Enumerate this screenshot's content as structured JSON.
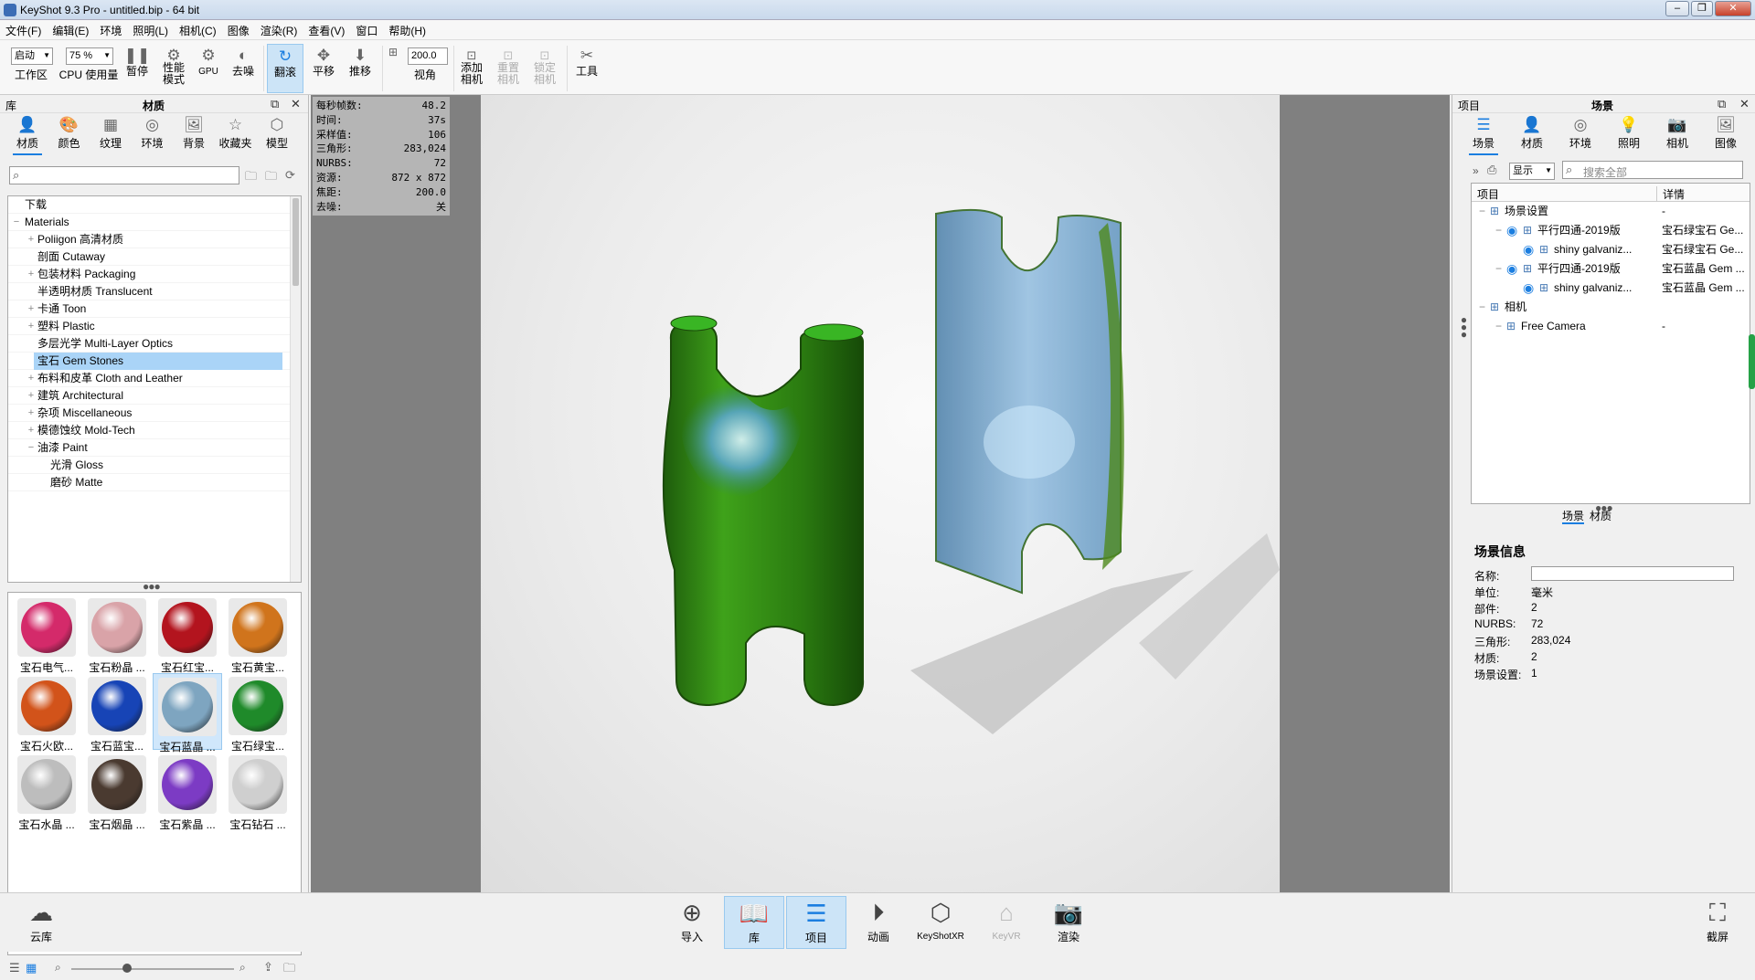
{
  "window": {
    "title": "KeyShot 9.3 Pro  - untitled.bip  - 64 bit"
  },
  "menu": [
    "文件(F)",
    "编辑(E)",
    "环境",
    "照明(L)",
    "相机(C)",
    "图像",
    "渲染(R)",
    "查看(V)",
    "窗口",
    "帮助(H)"
  ],
  "toolbar": {
    "workspace_value": "启动",
    "workspace_label": "工作区",
    "cpu_value": "75 %",
    "cpu_label": "CPU 使用量",
    "pause": "暂停",
    "perf_mode_1": "性能",
    "perf_mode_2": "模式",
    "gpu": "GPU",
    "denoise": "去噪",
    "tumble": "翻滚",
    "pan": "平移",
    "dolly": "推移",
    "fov_value": "200.0",
    "fov_label": "视角",
    "add_camera_1": "添加",
    "add_camera_2": "相机",
    "reset_camera_1": "重置",
    "reset_camera_2": "相机",
    "lock_camera_1": "锁定",
    "lock_camera_2": "相机",
    "tools": "工具"
  },
  "library": {
    "header_left": "库",
    "header_title": "材质",
    "tabs": [
      "材质",
      "颜色",
      "纹理",
      "环境",
      "背景",
      "收藏夹",
      "模型"
    ],
    "search_placeholder": "",
    "tree": [
      {
        "label": "下载",
        "indent": 0,
        "exp": ""
      },
      {
        "label": "Materials",
        "indent": 0,
        "exp": "−"
      },
      {
        "label": "Poliigon 高清材质",
        "indent": 1,
        "exp": "+"
      },
      {
        "label": "剖面 Cutaway",
        "indent": 1,
        "exp": ""
      },
      {
        "label": "包装材料 Packaging",
        "indent": 1,
        "exp": "+"
      },
      {
        "label": "半透明材质 Translucent",
        "indent": 1,
        "exp": ""
      },
      {
        "label": "卡通 Toon",
        "indent": 1,
        "exp": "+"
      },
      {
        "label": "塑料 Plastic",
        "indent": 1,
        "exp": "+"
      },
      {
        "label": "多层光学 Multi-Layer Optics",
        "indent": 1,
        "exp": ""
      },
      {
        "label": "宝石 Gem Stones",
        "indent": 1,
        "exp": "",
        "selected": true
      },
      {
        "label": "布料和皮革 Cloth and Leather",
        "indent": 1,
        "exp": "+"
      },
      {
        "label": "建筑 Architectural",
        "indent": 1,
        "exp": "+"
      },
      {
        "label": "杂项 Miscellaneous",
        "indent": 1,
        "exp": "+"
      },
      {
        "label": "模德蚀纹 Mold-Tech",
        "indent": 1,
        "exp": "+"
      },
      {
        "label": "油漆 Paint",
        "indent": 1,
        "exp": "−"
      },
      {
        "label": "光滑 Gloss",
        "indent": 2,
        "exp": ""
      },
      {
        "label": "磨砂 Matte",
        "indent": 2,
        "exp": ""
      }
    ],
    "thumbnails": [
      {
        "label": "宝石电气...",
        "color": "#d42a6a"
      },
      {
        "label": "宝石粉晶 ...",
        "color": "#d9a3a8"
      },
      {
        "label": "宝石红宝...",
        "color": "#b3141e"
      },
      {
        "label": "宝石黄宝...",
        "color": "#d0741c"
      },
      {
        "label": "宝石火欧...",
        "color": "#d2531a"
      },
      {
        "label": "宝石蓝宝...",
        "color": "#1744b6"
      },
      {
        "label": "宝石蓝晶 ...",
        "color": "#7ea5c0",
        "selected": true
      },
      {
        "label": "宝石绿宝...",
        "color": "#1f8a2a"
      },
      {
        "label": "宝石水晶 ...",
        "color": "#bdbdbd"
      },
      {
        "label": "宝石烟晶 ...",
        "color": "#4a3a30"
      },
      {
        "label": "宝石紫晶 ...",
        "color": "#7c3bc4"
      },
      {
        "label": "宝石钻石 ...",
        "color": "#cfcfcf"
      }
    ]
  },
  "hud": [
    {
      "k": "每秒帧数:",
      "v": "48.2"
    },
    {
      "k": "时间:",
      "v": "37s"
    },
    {
      "k": "采样值:",
      "v": "106"
    },
    {
      "k": "三角形:",
      "v": "283,024"
    },
    {
      "k": "NURBS:",
      "v": "72"
    },
    {
      "k": "资源:",
      "v": "872 x 872"
    },
    {
      "k": "焦距:",
      "v": "200.0"
    },
    {
      "k": "去噪:",
      "v": "关"
    }
  ],
  "project": {
    "header_left": "项目",
    "header_title": "场景",
    "tabs": [
      "场景",
      "材质",
      "环境",
      "照明",
      "相机",
      "图像"
    ],
    "display_value": "显示",
    "search_placeholder": "搜索全部",
    "col_item": "项目",
    "col_detail": "详情",
    "rows": [
      {
        "label": "场景设置",
        "detail": "-",
        "indent": 0
      },
      {
        "label": "平行四通-2019版",
        "detail": "宝石绿宝石 Ge...",
        "indent": 1,
        "eye": true
      },
      {
        "label": "shiny galvaniz...",
        "detail": "宝石绿宝石 Ge...",
        "indent": 2,
        "eye": true
      },
      {
        "label": "平行四通-2019版",
        "detail": "宝石蓝晶 Gem ...",
        "indent": 1,
        "eye": true
      },
      {
        "label": "shiny galvaniz...",
        "detail": "宝石蓝晶 Gem ...",
        "indent": 2,
        "eye": true
      },
      {
        "label": "相机",
        "detail": "",
        "indent": 0
      },
      {
        "label": "Free Camera",
        "detail": "-",
        "indent": 1
      }
    ],
    "subtabs": [
      "场景",
      "材质"
    ],
    "info_title": "场景信息",
    "info": [
      {
        "k": "名称:",
        "v": ""
      },
      {
        "k": "单位:",
        "v": "毫米"
      },
      {
        "k": "部件:",
        "v": "2"
      },
      {
        "k": "NURBS:",
        "v": "72"
      },
      {
        "k": "三角形:",
        "v": "283,024"
      },
      {
        "k": "材质:",
        "v": "2"
      },
      {
        "k": "场景设置:",
        "v": "1"
      }
    ]
  },
  "bottom": {
    "cloud": "云库",
    "import": "导入",
    "library": "库",
    "project": "项目",
    "animation": "动画",
    "keyshotxr": "KeyShotXR",
    "keyvr": "KeyVR",
    "render": "渲染",
    "screenshot": "截屏"
  },
  "colors": {
    "accent": "#1b7ee0",
    "selection": "#aad4f7",
    "green_glass": "#2d8f12",
    "blue_glass": "#86b3d6"
  }
}
